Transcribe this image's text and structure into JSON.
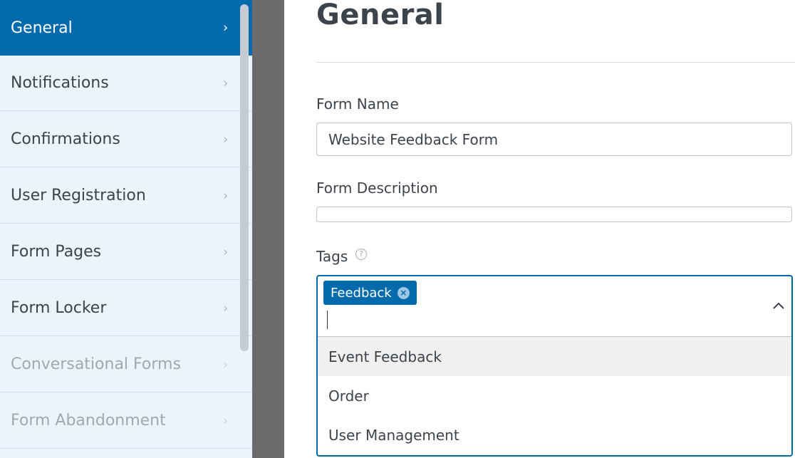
{
  "sidebar": {
    "items": [
      {
        "label": "General",
        "state": "active"
      },
      {
        "label": "Notifications",
        "state": "normal"
      },
      {
        "label": "Confirmations",
        "state": "normal"
      },
      {
        "label": "User Registration",
        "state": "normal"
      },
      {
        "label": "Form Pages",
        "state": "normal"
      },
      {
        "label": "Form Locker",
        "state": "normal"
      },
      {
        "label": "Conversational Forms",
        "state": "disabled"
      },
      {
        "label": "Form Abandonment",
        "state": "disabled"
      }
    ],
    "chevron": "›",
    "active_color": "#036aab"
  },
  "main": {
    "title": "General",
    "form_name": {
      "label": "Form Name",
      "value": "Website Feedback Form"
    },
    "form_description": {
      "label": "Form Description",
      "value": ""
    },
    "tags": {
      "label": "Tags",
      "help_icon": "?",
      "selected": [
        {
          "label": "Feedback",
          "remove_icon": "×"
        }
      ],
      "options": [
        {
          "label": "Event Feedback",
          "highlighted": true
        },
        {
          "label": "Order",
          "highlighted": false
        },
        {
          "label": "User Management",
          "highlighted": false
        }
      ]
    }
  }
}
